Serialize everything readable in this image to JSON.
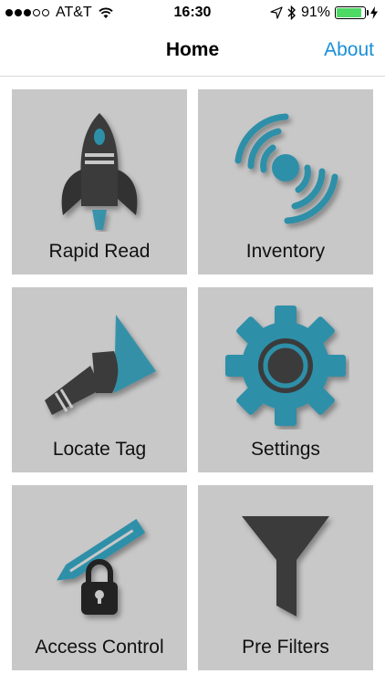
{
  "status_bar": {
    "carrier": "AT&T",
    "time": "16:30",
    "battery_percent": "91%",
    "battery_level": 0.91,
    "signal_dots_filled": 3,
    "signal_dots_total": 5
  },
  "nav": {
    "title": "Home",
    "about_label": "About"
  },
  "colors": {
    "accent": "#1a8fd8",
    "tile_background": "#c8c8c8",
    "icon_teal": "#2e8fa8",
    "icon_dark": "#333333",
    "battery_green": "#4cd964"
  },
  "tiles": [
    {
      "label": "Rapid Read",
      "icon": "rocket-icon"
    },
    {
      "label": "Inventory",
      "icon": "signal-waves-icon"
    },
    {
      "label": "Locate Tag",
      "icon": "flashlight-icon"
    },
    {
      "label": "Settings",
      "icon": "gear-icon"
    },
    {
      "label": "Access Control",
      "icon": "pencil-lock-icon"
    },
    {
      "label": "Pre Filters",
      "icon": "funnel-icon"
    }
  ]
}
